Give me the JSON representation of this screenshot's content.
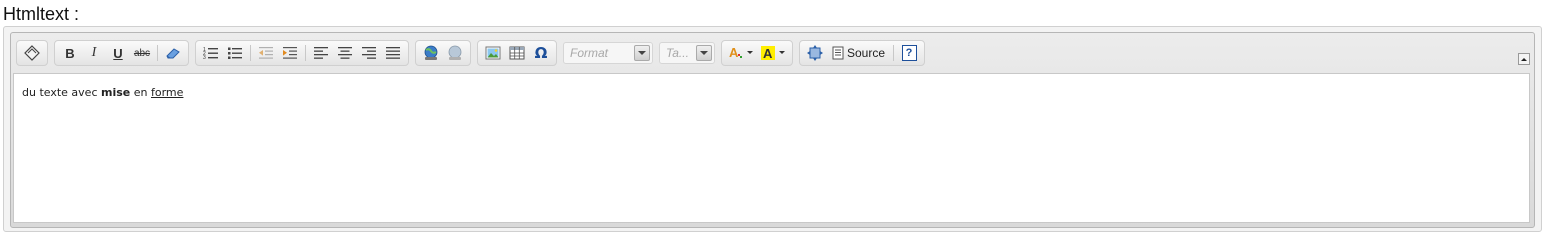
{
  "field": {
    "label": "Htmltext :"
  },
  "toolbar": {
    "format_placeholder": "Format",
    "size_placeholder": "Ta...",
    "source_label": "Source",
    "bold_label": "B",
    "italic_label": "I",
    "underline_label": "U",
    "strike_label": "abc",
    "omega_label": "Ω",
    "help_label": "?"
  },
  "content": {
    "part1": "du texte avec",
    "bold_word": "mise",
    "part2": "en",
    "underlined_word": "forme"
  },
  "colors": {
    "text_color_icon": "#f0a020",
    "bg_color_icon": "#ffee00"
  }
}
